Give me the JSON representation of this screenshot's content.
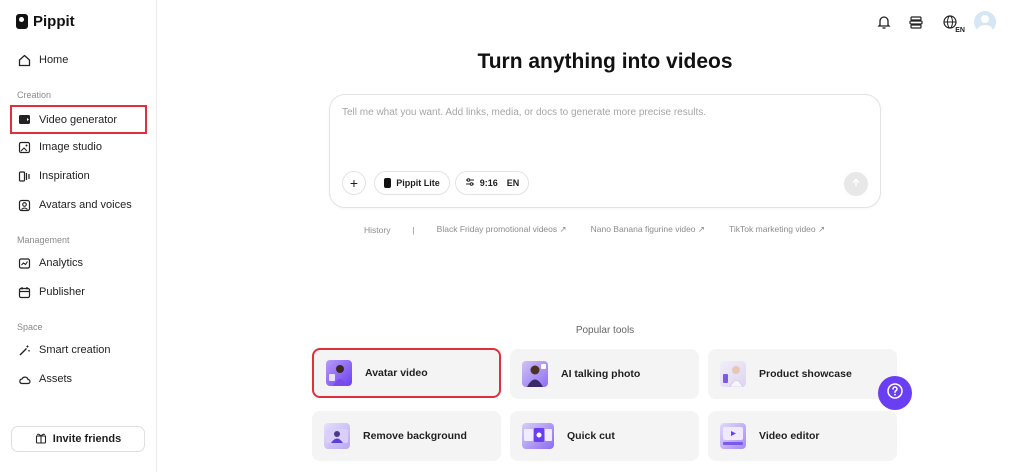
{
  "app": {
    "name": "Pippit"
  },
  "sidebar": {
    "home": "Home",
    "creation_label": "Creation",
    "creation_items": [
      "Video generator",
      "Image studio",
      "Inspiration",
      "Avatars and voices"
    ],
    "management_label": "Management",
    "management_items": [
      "Analytics",
      "Publisher"
    ],
    "space_label": "Space",
    "space_items": [
      "Smart creation",
      "Assets"
    ],
    "invite": "Invite friends",
    "active_item": "Video generator"
  },
  "header": {
    "language": "EN",
    "icons": [
      "bell-icon",
      "stack-icon",
      "globe-language-icon",
      "user-avatar"
    ]
  },
  "main": {
    "headline": "Turn anything into videos",
    "prompt": {
      "placeholder": "Tell me what you want. Add links, media, or docs to generate more precise results.",
      "value": "",
      "model": "Pippit Lite",
      "ratio": "9:16",
      "language": "EN"
    },
    "suggestions": {
      "history": "History",
      "separator": "|",
      "items": [
        "Black Friday promotional videos ↗",
        "Nano Banana figurine video ↗",
        "TikTok marketing video ↗"
      ]
    },
    "popular_label": "Popular tools",
    "tools": [
      "Avatar video",
      "AI talking photo",
      "Product showcase",
      "Remove background",
      "Quick cut",
      "Video editor"
    ]
  },
  "colors": {
    "accent": "#6a3ef2",
    "highlight": "#e0303a",
    "tool_bg": "#f4f4f5"
  }
}
